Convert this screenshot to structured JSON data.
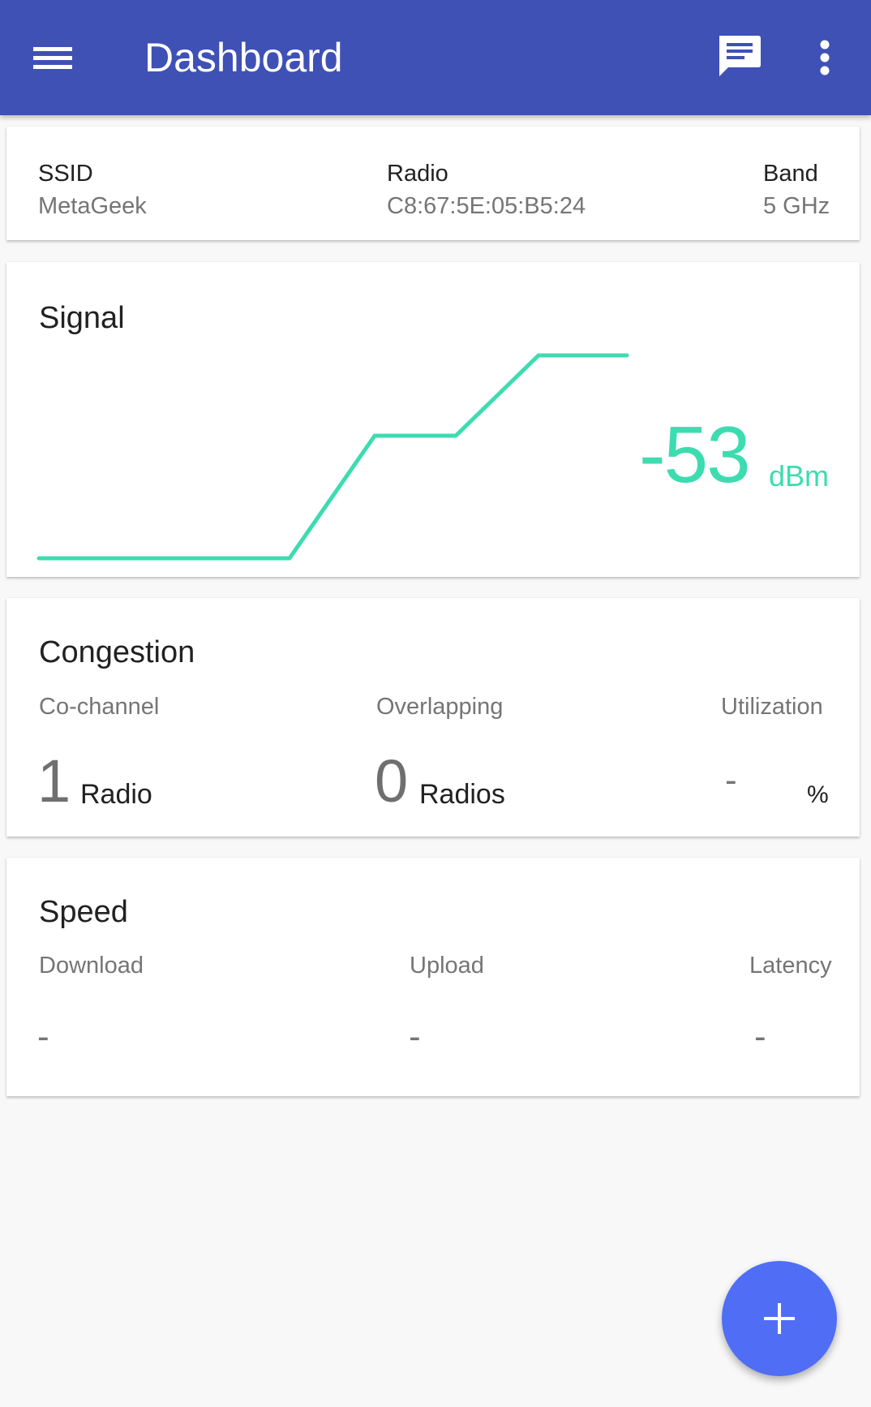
{
  "appbar": {
    "title": "Dashboard",
    "icons": {
      "menu": "hamburger-menu-icon",
      "chat": "chat-icon",
      "more": "more-vert-icon"
    },
    "color": "#3f51b5"
  },
  "network": {
    "ssid_label": "SSID",
    "ssid_value": "MetaGeek",
    "radio_label": "Radio",
    "radio_value": "C8:67:5E:05:B5:24",
    "band_label": "Band",
    "band_value": "5 GHz"
  },
  "signal": {
    "title": "Signal",
    "value": "-53",
    "unit": "dBm",
    "color": "#3ddcb0"
  },
  "congestion": {
    "title": "Congestion",
    "cochannel_label": "Co-channel",
    "cochannel_value": "1",
    "cochannel_unit": "Radio",
    "overlapping_label": "Overlapping",
    "overlapping_value": "0",
    "overlapping_unit": "Radios",
    "utilization_label": "Utilization",
    "utilization_value": "-",
    "utilization_unit": "%"
  },
  "speed": {
    "title": "Speed",
    "download_label": "Download",
    "download_value": "-",
    "upload_label": "Upload",
    "upload_value": "-",
    "latency_label": "Latency",
    "latency_value": "-"
  },
  "fab": {
    "icon": "plus-icon",
    "color": "#4f6ef5"
  }
}
